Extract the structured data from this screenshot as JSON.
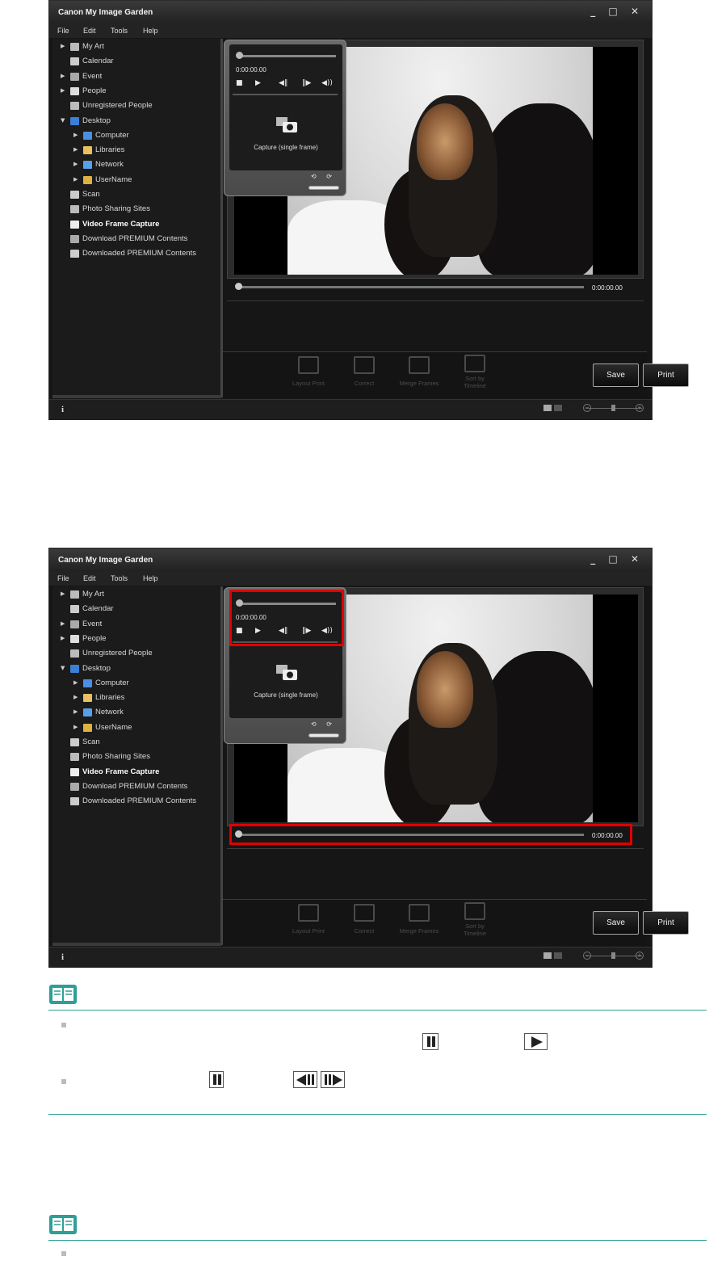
{
  "app": {
    "title": "Canon My Image Garden",
    "window_controls": "_ □ ✕",
    "menu": [
      "File",
      "Edit",
      "Tools",
      "Help"
    ],
    "sidebar": [
      {
        "label": "My Art",
        "arrow": "▶",
        "icon": "my-art-icon",
        "level": 0
      },
      {
        "label": "Calendar",
        "arrow": "",
        "icon": "calendar-icon",
        "level": 0
      },
      {
        "label": "Event",
        "arrow": "▶",
        "icon": "event-icon",
        "level": 0
      },
      {
        "label": "People",
        "arrow": "▶",
        "icon": "people-icon",
        "level": 0
      },
      {
        "label": "Unregistered People",
        "arrow": "",
        "icon": "unregistered-people-icon",
        "level": 0
      },
      {
        "label": "Desktop",
        "arrow": "▼",
        "icon": "desktop-icon",
        "level": 0
      },
      {
        "label": "Computer",
        "arrow": "▶",
        "icon": "computer-icon",
        "level": 1
      },
      {
        "label": "Libraries",
        "arrow": "▶",
        "icon": "libraries-icon",
        "level": 1
      },
      {
        "label": "Network",
        "arrow": "▶",
        "icon": "network-icon",
        "level": 1
      },
      {
        "label": "UserName",
        "arrow": "▶",
        "icon": "user-folder-icon",
        "level": 1
      },
      {
        "label": "Scan",
        "arrow": "",
        "icon": "scan-icon",
        "level": 0
      },
      {
        "label": "Photo Sharing Sites",
        "arrow": "",
        "icon": "photo-sharing-icon",
        "level": 0
      },
      {
        "label": "Video Frame Capture",
        "arrow": "",
        "icon": "video-frame-capture-icon",
        "level": 0,
        "selected": true
      },
      {
        "label": "Download PREMIUM Contents",
        "arrow": "",
        "icon": "download-premium-icon",
        "level": 0
      },
      {
        "label": "Downloaded PREMIUM Contents",
        "arrow": "",
        "icon": "downloaded-premium-icon",
        "level": 0
      }
    ],
    "playback": {
      "time": "0:00:00.00",
      "buttons": [
        {
          "name": "stop-icon",
          "glyph": "■"
        },
        {
          "name": "play-icon",
          "glyph": "▶"
        },
        {
          "name": "frame-back-icon",
          "glyph": "◀‖"
        },
        {
          "name": "frame-forward-icon",
          "glyph": "‖▶"
        },
        {
          "name": "volume-icon",
          "glyph": "◀))"
        }
      ],
      "capture_label": "Capture (single frame)",
      "mini_icons": "⟲ ⟳"
    },
    "seek_time": "0:00:00.00",
    "tools": [
      "Layout Print",
      "Correct",
      "Merge Frames",
      "Sort by Timeline"
    ],
    "save_label": "Save",
    "print_label": "Print",
    "status_info": "i",
    "zoom_minus": "−",
    "zoom_plus": "+"
  },
  "colors": {
    "highlight": "#e00000",
    "note_line": "#2d9f96",
    "app_background": "#161616"
  }
}
